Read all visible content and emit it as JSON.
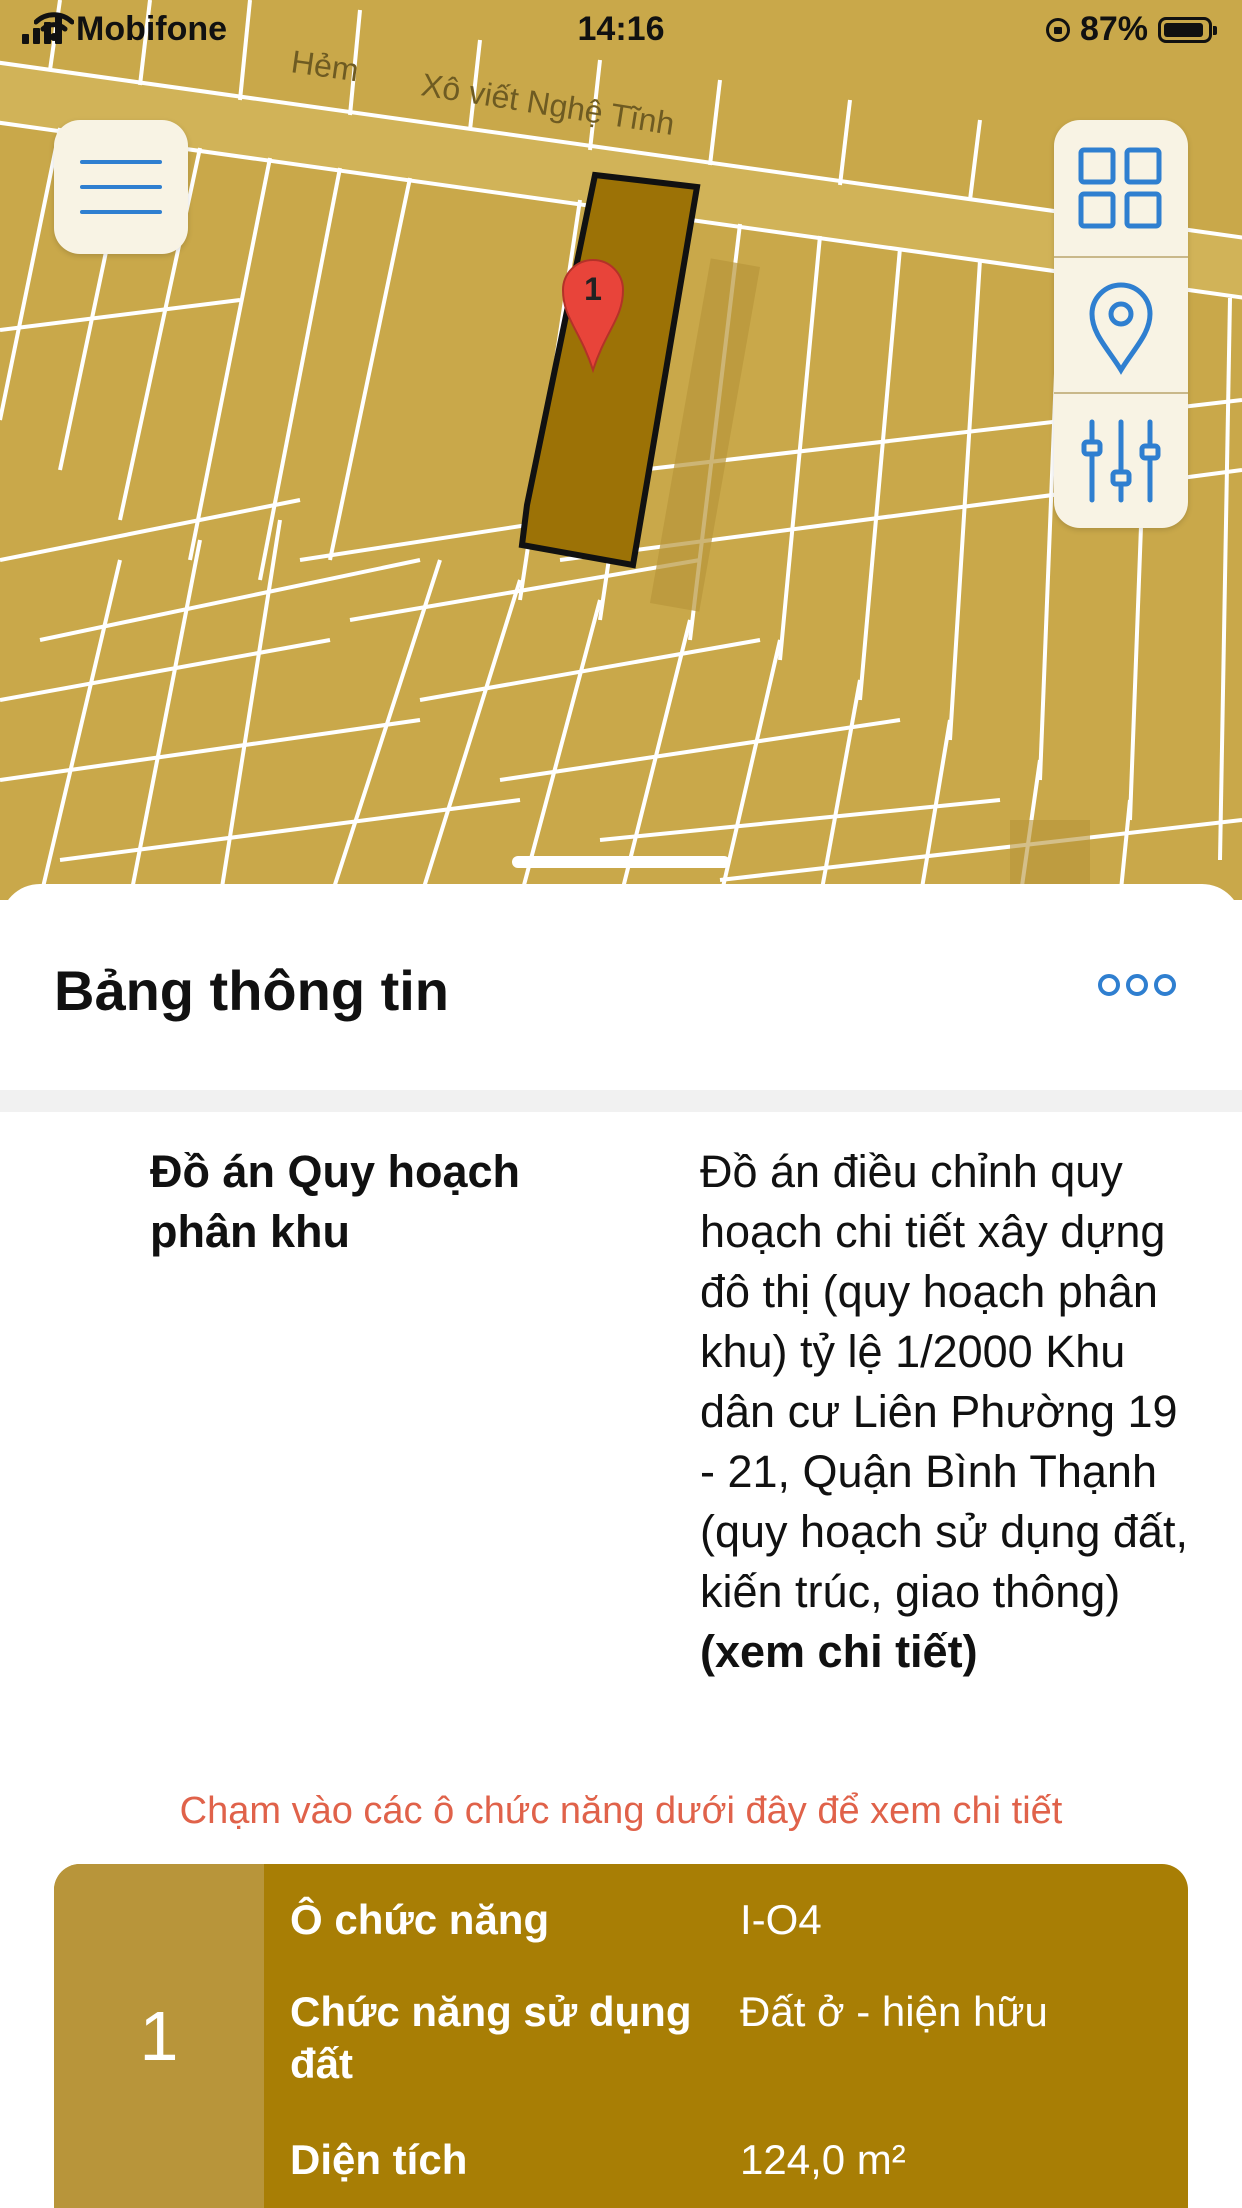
{
  "status_bar": {
    "carrier": "Mobifone",
    "time": "14:16",
    "battery": "87%"
  },
  "map": {
    "street_labels": [
      "Hẻm",
      "Xô viết Nghệ Tĩnh"
    ],
    "marker_label": "1",
    "colors": {
      "land": "#c9a84a",
      "selected_parcel": "#9c7206",
      "parcel_lines": "#ffffff",
      "marker": "#e8443a",
      "control_icon": "#2f7fd0"
    },
    "controls": {
      "menu_icon": "hamburger-icon",
      "buttons": [
        "grid-icon",
        "location-pin-icon",
        "sliders-icon"
      ]
    }
  },
  "sheet": {
    "title": "Bảng thông tin",
    "more_icon": "more-dots-icon",
    "info": {
      "label": "Đồ án Quy hoạch phân khu",
      "value": "Đồ án điều chỉnh quy hoạch chi tiết xây dựng đô thị (quy hoạch phân khu) tỷ lệ 1/2000  Khu dân cư Liên Phường 19 - 21, Quận Bình Thạnh (quy hoạch sử dụng đất, kiến trúc, giao thông)",
      "link": "(xem chi tiết)"
    },
    "hint": "Chạm vào các ô chức năng dưới đây để xem chi tiết",
    "function_cell": {
      "number": "1",
      "rows": [
        {
          "key": "Ô chức năng",
          "value": "I-O4"
        },
        {
          "key": "Chức năng sử dụng đất",
          "value": "Đất ở - hiện hữu"
        },
        {
          "key": "Diện tích",
          "value": "124,0 m²"
        }
      ],
      "colors": {
        "card": "#a87e05",
        "number_column": "#b8953a"
      }
    }
  }
}
